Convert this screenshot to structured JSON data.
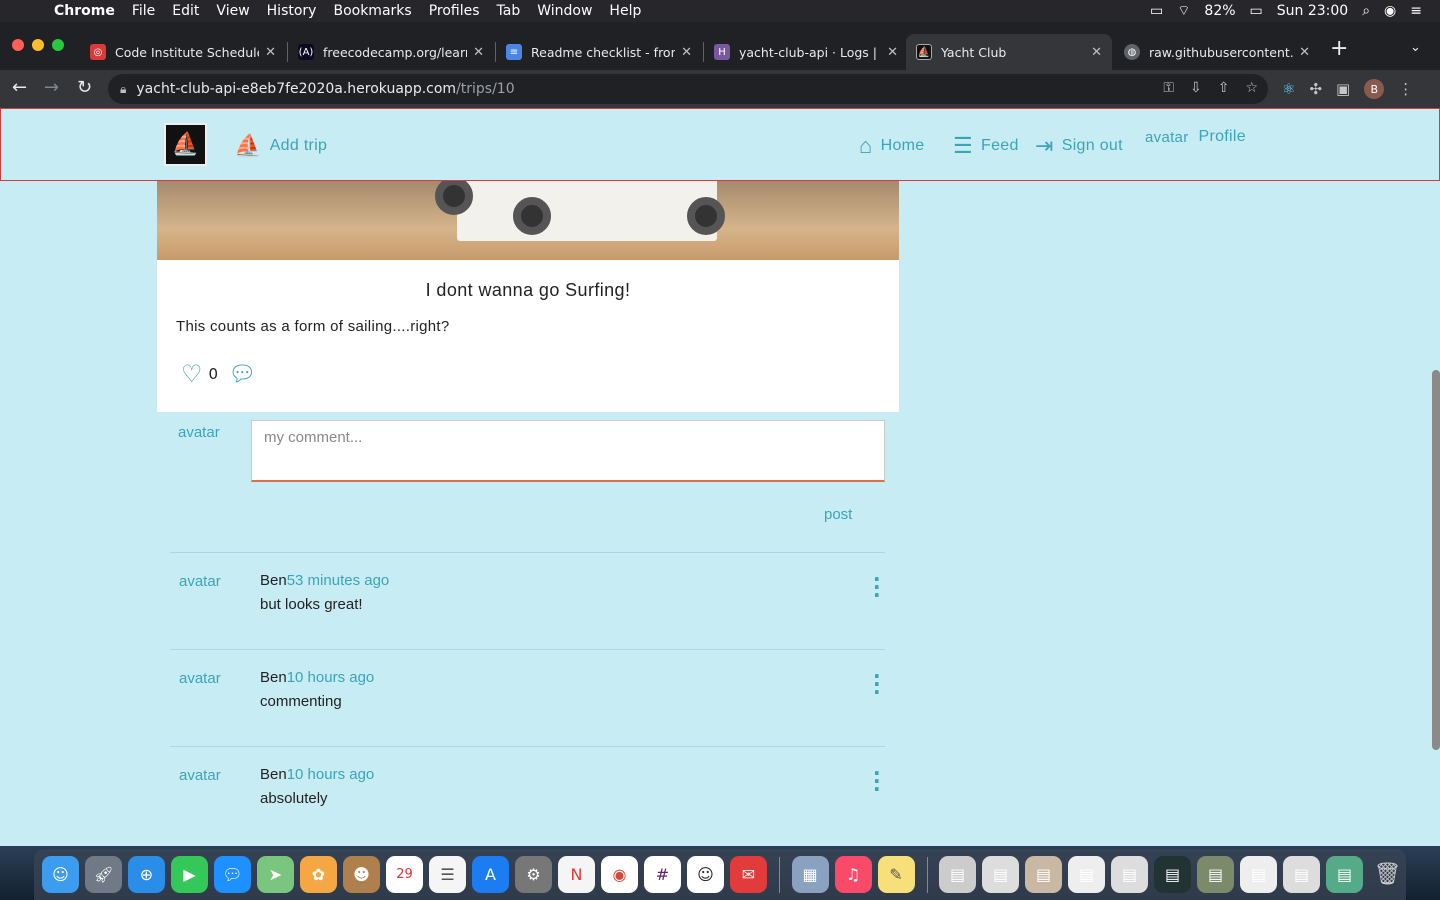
{
  "menubar": {
    "app": "Chrome",
    "items": [
      "File",
      "Edit",
      "View",
      "History",
      "Bookmarks",
      "Profiles",
      "Tab",
      "Window",
      "Help"
    ],
    "battery": "82%",
    "clock": "Sun 23:00"
  },
  "tabs": [
    {
      "title": "Code Institute Schedule",
      "favicon_color": "#d93b3b"
    },
    {
      "title": "freecodecamp.org/learn/",
      "favicon_color": "#0a0a23"
    },
    {
      "title": "Readme checklist - front",
      "favicon_color": "#4a86e8"
    },
    {
      "title": "yacht-club-api · Logs | H",
      "favicon_color": "#79589f"
    },
    {
      "title": "Yacht Club",
      "favicon_color": "#111111"
    },
    {
      "title": "raw.githubusercontent.c",
      "favicon_color": "#5f6368"
    }
  ],
  "browser": {
    "url_host": "yacht-club-api-e8eb7fe2020a.herokuapp.com",
    "url_path": "/trips/10",
    "profile_initial": "B"
  },
  "navbar": {
    "add_trip": "Add trip",
    "home": "Home",
    "feed": "Feed",
    "sign_out": "Sign out",
    "avatar_alt": "avatar",
    "profile": "Profile"
  },
  "trip": {
    "title": "I dont wanna go Surfing!",
    "description": "This counts as a form of sailing....right?",
    "likes_count": "0"
  },
  "comment_form": {
    "avatar_alt": "avatar",
    "placeholder": "my comment...",
    "post_label": "post"
  },
  "comments": [
    {
      "avatar_alt": "avatar",
      "owner": "Ben",
      "time": "53 minutes ago",
      "body": "but looks great!"
    },
    {
      "avatar_alt": "avatar",
      "owner": "Ben",
      "time": "10 hours ago",
      "body": "commenting"
    },
    {
      "avatar_alt": "avatar",
      "owner": "Ben",
      "time": "10 hours ago",
      "body": "absolutely"
    }
  ],
  "colors": {
    "accent": "#3aa4b8",
    "page_bg": "#c8ecf3",
    "navbar_border": "#d93b3b"
  }
}
